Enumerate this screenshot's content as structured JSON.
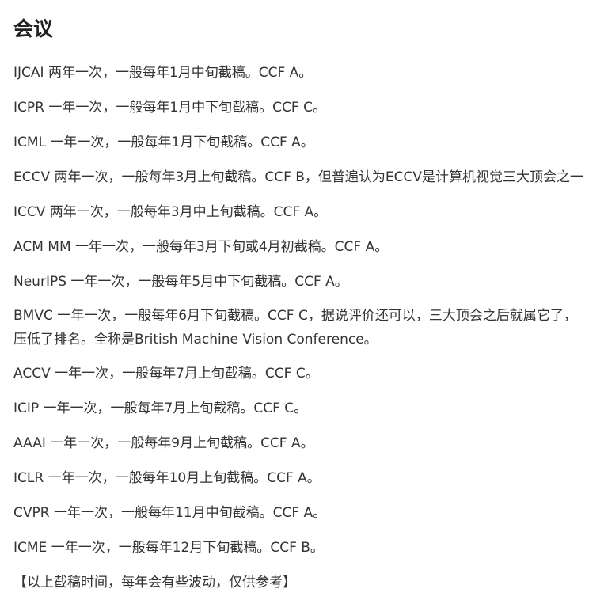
{
  "heading": "会议",
  "items": [
    "IJCAI 两年一次，一般每年1月中旬截稿。CCF A。",
    "ICPR 一年一次，一般每年1月中下旬截稿。CCF C。",
    "ICML 一年一次，一般每年1月下旬截稿。CCF A。",
    "ECCV 两年一次，一般每年3月上旬截稿。CCF B，但普遍认为ECCV是计算机视觉三大顶会之一",
    "ICCV 两年一次，一般每年3月中上旬截稿。CCF A。",
    "ACM MM 一年一次，一般每年3月下旬或4月初截稿。CCF A。",
    "NeurIPS 一年一次，一般每年5月中下旬截稿。CCF A。"
  ],
  "bmvc": {
    "line1": "BMVC 一年一次，一般每年6月下旬截稿。CCF C，据说评价还可以，三大顶会之后就属它了，",
    "line2": "压低了排名。全称是British Machine Vision Conference。"
  },
  "items2": [
    "ACCV 一年一次，一般每年7月上旬截稿。CCF C。",
    "ICIP 一年一次，一般每年7月上旬截稿。CCF C。",
    "AAAI 一年一次，一般每年9月上旬截稿。CCF A。",
    "ICLR 一年一次，一般每年10月上旬截稿。CCF A。",
    "CVPR 一年一次，一般每年11月中旬截稿。CCF A。",
    "ICME 一年一次，一般每年12月下旬截稿。CCF B。"
  ],
  "note": "【以上截稿时间，每年会有些波动，仅供参考】"
}
